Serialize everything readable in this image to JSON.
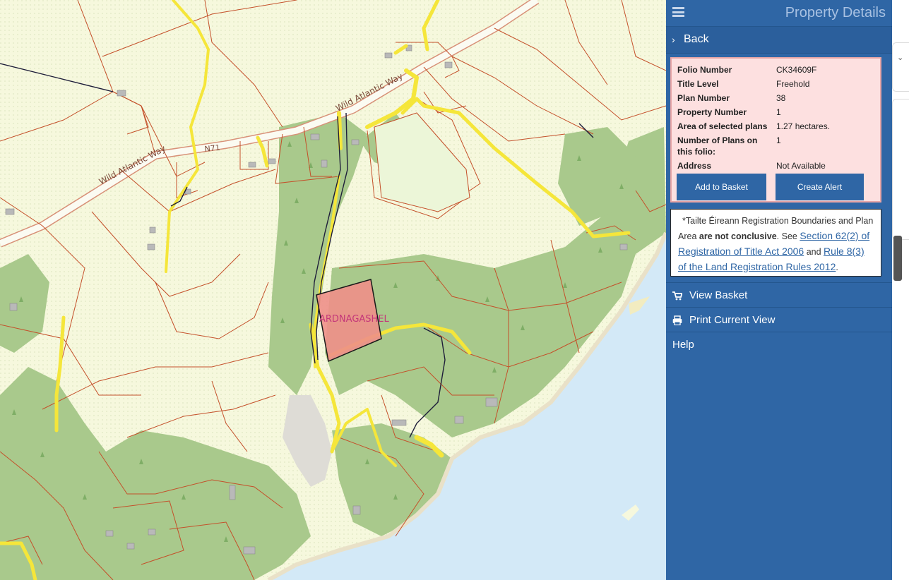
{
  "panel": {
    "title": "Property Details",
    "back_label": "Back",
    "details": [
      {
        "key": "Folio Number",
        "value": "CK34609F"
      },
      {
        "key": "Title Level",
        "value": "Freehold"
      },
      {
        "key": "Plan Number",
        "value": "38"
      },
      {
        "key": "Property Number",
        "value": "1"
      },
      {
        "key": "Area of selected plans",
        "value": "1.27 hectares."
      },
      {
        "key": "Number of Plans on this folio:",
        "value": "1"
      },
      {
        "key": "Address",
        "value": "Not Available"
      }
    ],
    "add_to_basket_label": "Add to Basket",
    "create_alert_label": "Create Alert",
    "notice": {
      "prefix": "*Tailte Éireann Registration Boundaries and Plan Area",
      "bold": "are not conclusive",
      "see": ". See",
      "link1": "Section 62(2) of Registration of Title Act 2006",
      "and": "and",
      "link2": "Rule 8(3) of the Land Registration Rules 2012",
      "end": "."
    },
    "menu": {
      "view_basket": "View Basket",
      "print_view": "Print Current View",
      "help": "Help"
    }
  },
  "map": {
    "labels": {
      "road1": "Wild Atlantic Way",
      "road2": "Wild Atlantic Way",
      "road_code": "N71",
      "townland": "ARDNAGASHEL"
    },
    "colors": {
      "field": "#f6f8dd",
      "woodland": "#a9c98c",
      "sea": "#d3e9f7",
      "boundary": "#c4502a",
      "road_yellow": "#f5e63a",
      "selected_plot": "#ee8f88"
    }
  }
}
